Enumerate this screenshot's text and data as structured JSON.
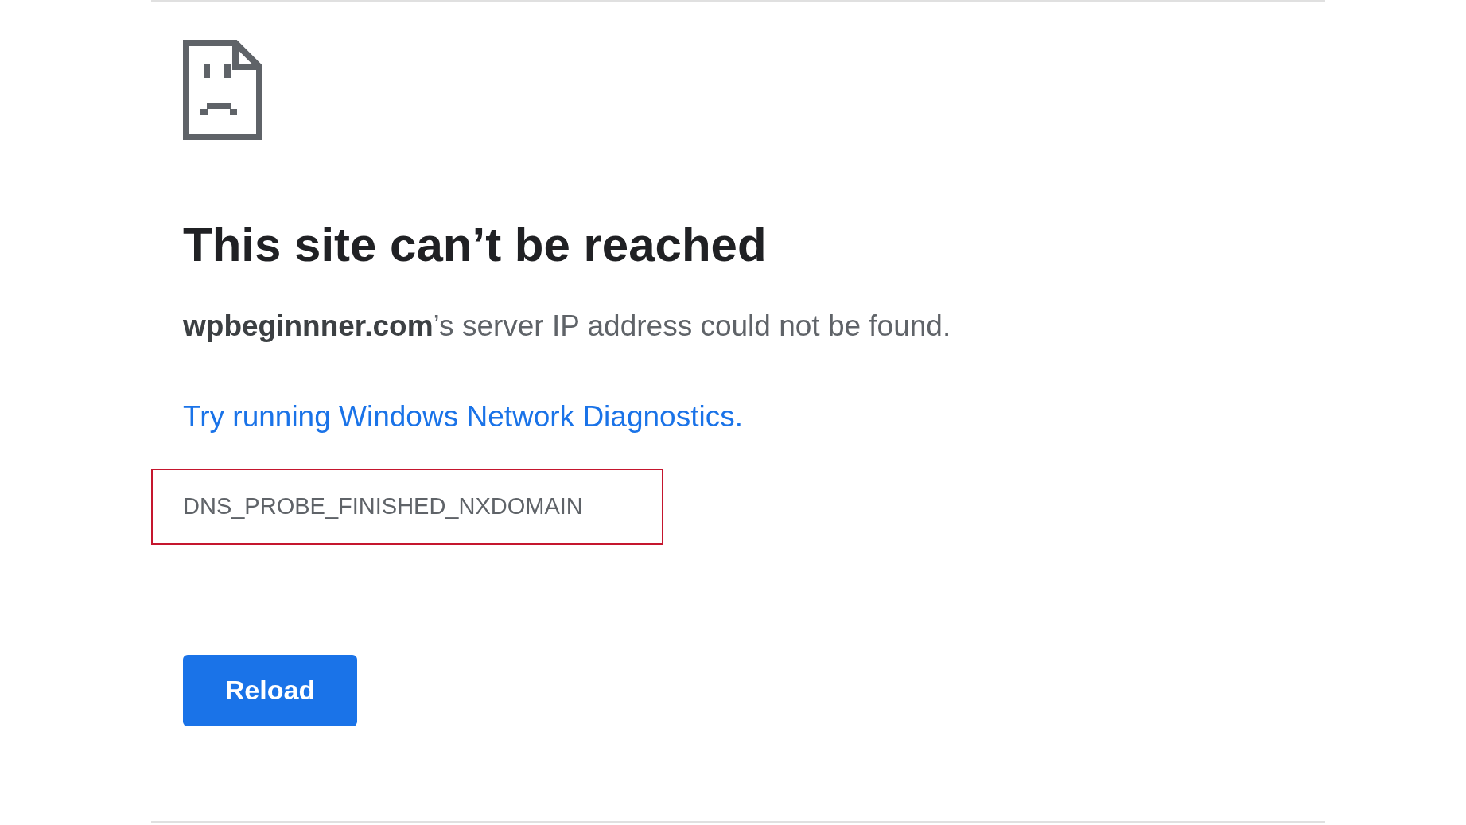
{
  "heading": "This site can’t be reached",
  "message": "**wpbeginnner.com**’s server IP address could not be found.",
  "suggestion_link": "Try running Windows Network Diagnostics.",
  "error_code": "DNS_PROBE_FINISHED_NXDOMAIN",
  "buttons": [
    {
      "label": "Reload"
    }
  ]
}
